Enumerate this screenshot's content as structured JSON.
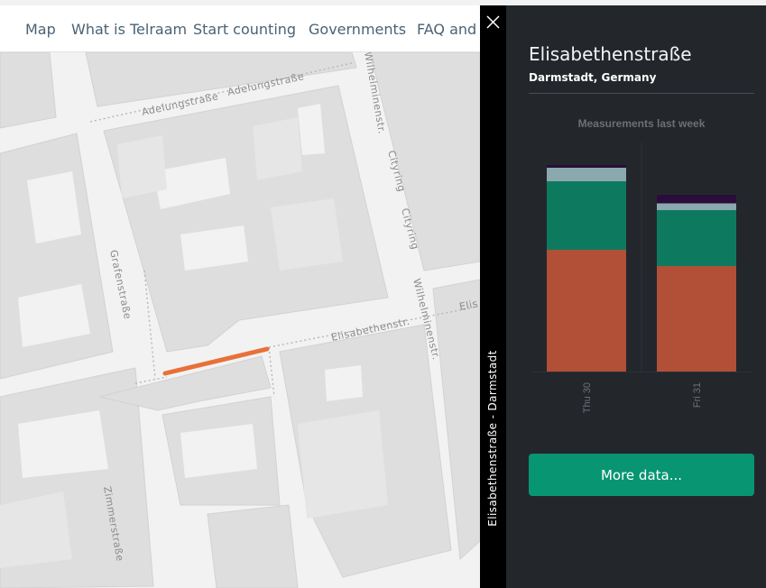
{
  "nav": {
    "items": [
      {
        "label": "Map"
      },
      {
        "label": "What is Telraam"
      },
      {
        "label": "Start counting"
      },
      {
        "label": "Governments"
      },
      {
        "label": "FAQ and s"
      }
    ]
  },
  "map": {
    "street_labels": [
      "Adelungstraße",
      "Adelungstraße",
      "Wilhelminenstr.",
      "Cityring",
      "Cityring",
      "Grafenstraße",
      "Elisabethenstr.",
      "Wilhelminenstr.",
      "Zimmerstraße",
      "Elis"
    ],
    "highlight_color": "#e8703a"
  },
  "side_tab": {
    "label": "Elisabethenstraße - Darmstadt",
    "close_icon": "close-icon"
  },
  "panel": {
    "title": "Elisabethenstraße",
    "subtitle": "Darmstadt, Germany",
    "more_button": "More data..."
  },
  "chart_data": {
    "type": "bar",
    "title": "Measurements last week",
    "categories": [
      "Thu 30",
      "Fri 31"
    ],
    "stacked": true,
    "series": [
      {
        "values": [
          1350,
          1170
        ],
        "color": "#b14f37"
      },
      {
        "values": [
          760,
          620
        ],
        "color": "#0d7a5f"
      },
      {
        "values": [
          150,
          75
        ],
        "color": "#8aa9ae"
      },
      {
        "values": [
          30,
          95
        ],
        "color": "#2a0d3a"
      }
    ],
    "ylim": [
      0,
      2500
    ],
    "legend": "none",
    "grid": false
  }
}
